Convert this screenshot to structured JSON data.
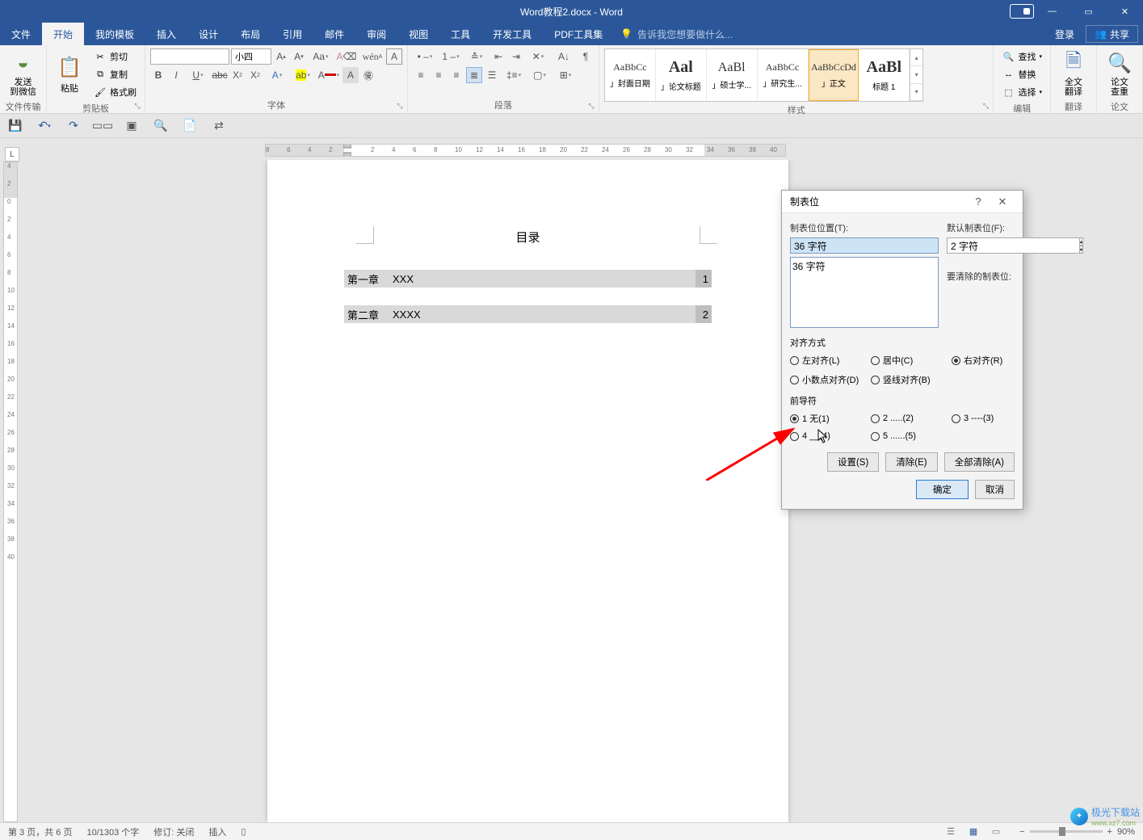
{
  "title": "Word教程2.docx - Word",
  "menu": {
    "file": "文件",
    "home": "开始",
    "mytpl": "我的模板",
    "insert": "插入",
    "design": "设计",
    "layout": "布局",
    "ref": "引用",
    "mail": "邮件",
    "review": "审阅",
    "view": "视图",
    "tools": "工具",
    "dev": "开发工具",
    "pdf": "PDF工具集",
    "tell": "告诉我您想要做什么...",
    "login": "登录",
    "share": "共享"
  },
  "ribbon": {
    "sendwx": "发送\n到微信",
    "filetrans": "文件传输",
    "paste": "粘贴",
    "cut": "剪切",
    "copy": "复制",
    "format": "格式刷",
    "clipboard": "剪贴板",
    "font_group": "字体",
    "para_group": "段落",
    "styles_group": "样式",
    "font_name": "",
    "font_size": "小四",
    "styles": {
      "s1": "AaBbCc",
      "l1": "」封面日期",
      "s2": "Aal",
      "l2": "」论文标题",
      "s3": "AaBl",
      "l3": "」硕士学...",
      "s4": "AaBbCc",
      "l4": "」研究生...",
      "s5": "AaBbCcDd",
      "l5": "」正文",
      "s6": "AaBl",
      "l6": "标题 1"
    },
    "find": "查找",
    "replace": "替换",
    "select": "选择",
    "edit": "编辑",
    "translate": "全文\n翻译",
    "translate_g": "翻译",
    "paperchk": "论文\n查重",
    "paperchk_g": "论文"
  },
  "doc": {
    "title": "目录",
    "chap1": "第一章",
    "txt1": "XXX",
    "pg1": "1",
    "chap2": "第二章",
    "txt2": "XXXX",
    "pg2": "2"
  },
  "dialog": {
    "title": "制表位",
    "pos_label": "制表位位置(T):",
    "pos_value": "36 字符",
    "list_item": "36 字符",
    "default_label": "默认制表位(F):",
    "default_value": "2 字符",
    "clear_label": "要清除的制表位:",
    "align_section": "对齐方式",
    "align_left": "左对齐(L)",
    "align_center": "居中(C)",
    "align_right": "右对齐(R)",
    "align_decimal": "小数点对齐(D)",
    "align_bar": "竖线对齐(B)",
    "leader_section": "前导符",
    "leader1": "1 无(1)",
    "leader2": "2 .....(2)",
    "leader3": "3 ----(3)",
    "leader4": "4 __(4)",
    "leader5": "5 ......(5)",
    "btn_set": "设置(S)",
    "btn_clear": "清除(E)",
    "btn_clearall": "全部清除(A)",
    "btn_ok": "确定",
    "btn_cancel": "取消"
  },
  "status": {
    "pages": "第 3 页，共 6 页",
    "words": "10/1303 个字",
    "track": "修订: 关闭",
    "insert": "插入",
    "zoom": "90%"
  },
  "watermark": {
    "text": "极光下载站",
    "url": "www.xz7.com"
  },
  "ruler_corner": "L"
}
